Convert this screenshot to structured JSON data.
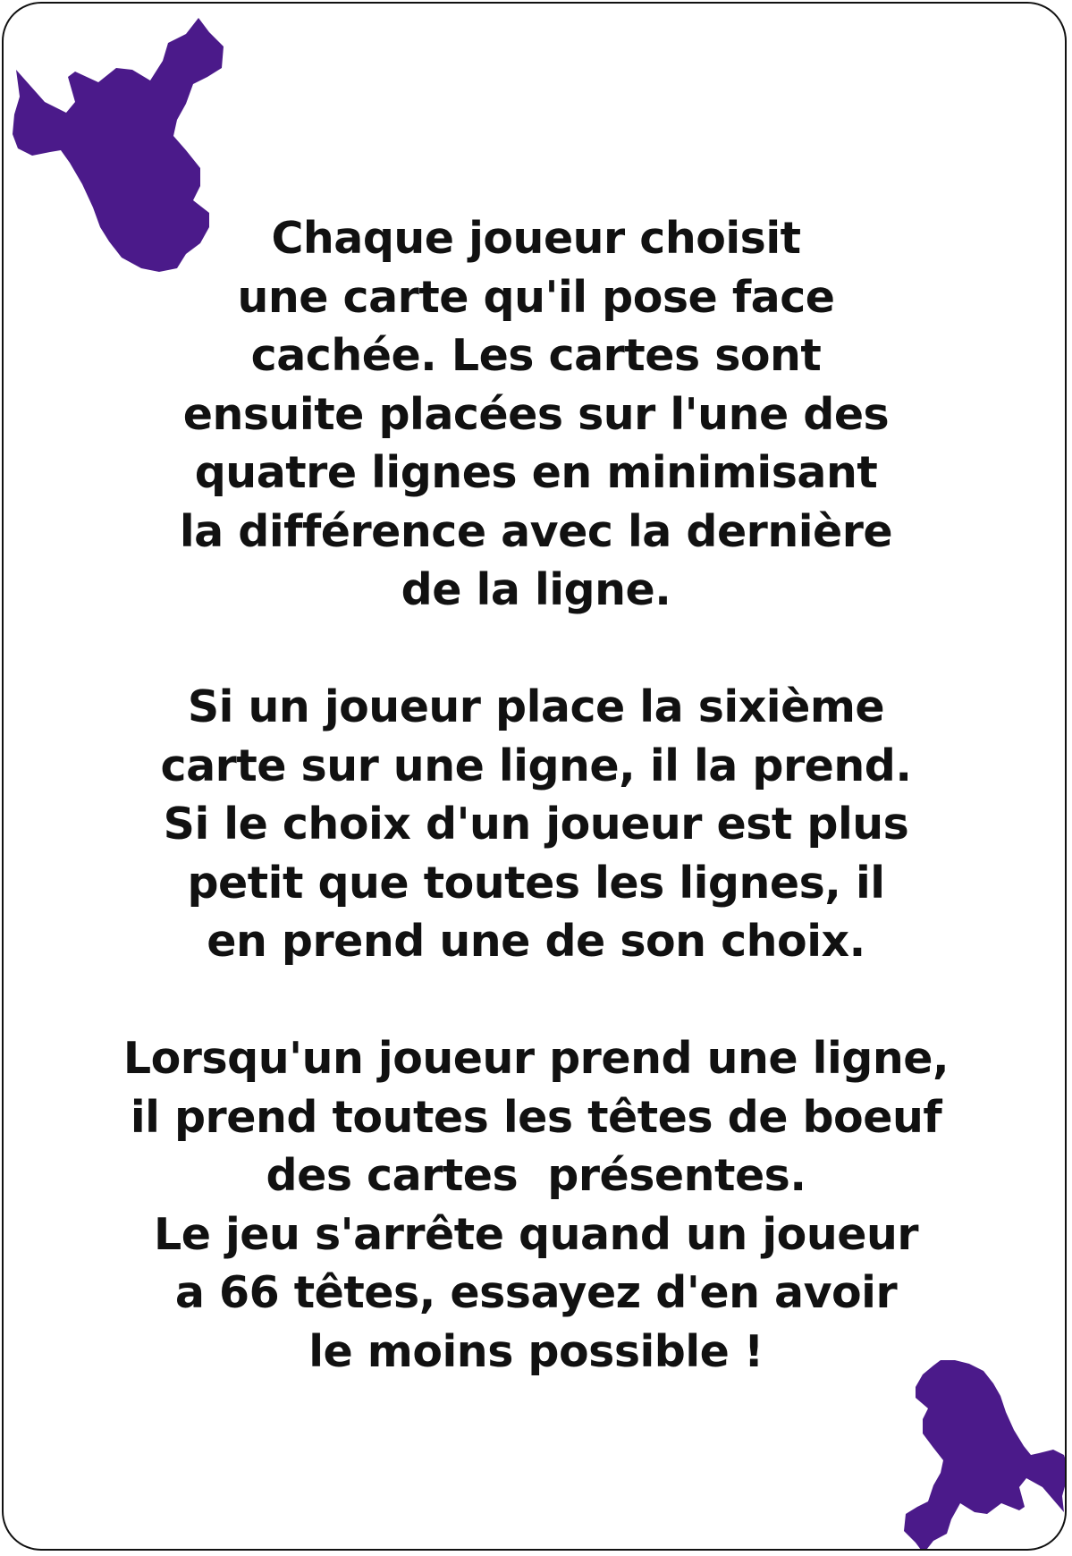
{
  "card": {
    "accent_color": "#4b1a8a",
    "border_color": "#111111",
    "corner_icons": [
      "bull-head-icon",
      "bull-head-icon"
    ]
  },
  "rules": {
    "paragraph_1": [
      "Chaque joueur choisit",
      "une carte qu'il pose face",
      "cachée. Les cartes sont",
      "ensuite placées sur l'une des",
      "quatre lignes en minimisant",
      "la différence avec la dernière",
      "de la ligne."
    ],
    "paragraph_2": [
      "Si un joueur place la sixième",
      "carte sur une ligne, il la prend.",
      "Si le choix d'un joueur est plus",
      "petit que toutes les lignes, il",
      "en prend une de son choix."
    ],
    "paragraph_3": [
      "Lorsqu'un joueur prend une ligne,",
      "il prend toutes les têtes de boeuf",
      "des cartes  présentes.",
      "Le jeu s'arrête quand un joueur",
      "a 66 têtes, essayez d'en avoir",
      "le moins possible !"
    ]
  }
}
